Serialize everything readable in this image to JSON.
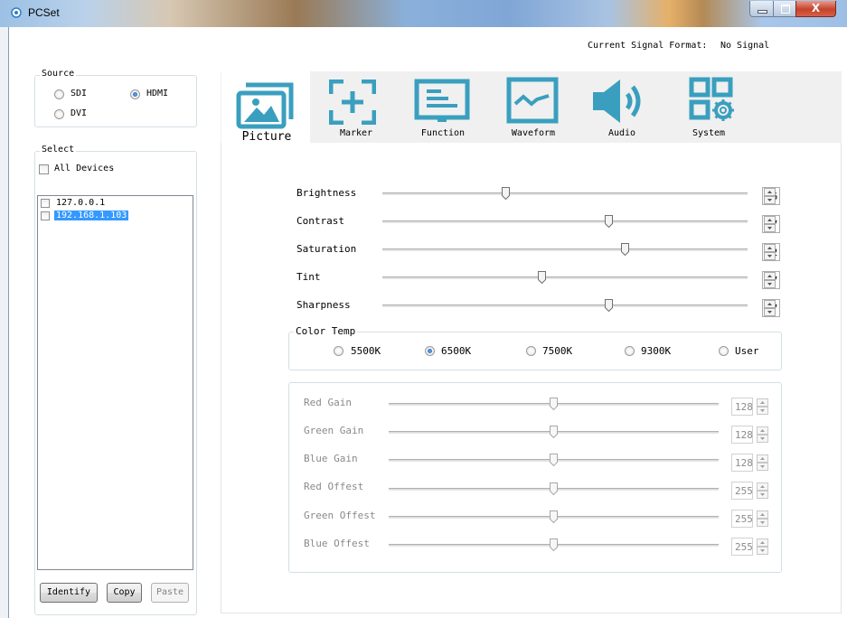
{
  "window": {
    "title": "PCSet",
    "close_glyph": "X"
  },
  "signal": {
    "label": "Current Signal Format:",
    "value": "No Signal"
  },
  "source": {
    "legend": "Source",
    "options": [
      {
        "label": "SDI",
        "selected": false
      },
      {
        "label": "HDMI",
        "selected": true
      },
      {
        "label": "DVI",
        "selected": false
      }
    ]
  },
  "select": {
    "legend": "Select",
    "all_devices": "All Devices",
    "devices": [
      "127.0.0.1",
      "192.168.1.103"
    ]
  },
  "buttons": {
    "identify": "Identify",
    "copy": "Copy",
    "paste": "Paste"
  },
  "tabs": [
    {
      "label": "Picture",
      "icon": "picture-icon",
      "active": true
    },
    {
      "label": "Marker",
      "icon": "marker-icon",
      "active": false
    },
    {
      "label": "Function",
      "icon": "function-icon",
      "active": false
    },
    {
      "label": "Waveform",
      "icon": "waveform-icon",
      "active": false
    },
    {
      "label": "Audio",
      "icon": "audio-icon",
      "active": false
    },
    {
      "label": "System",
      "icon": "system-icon",
      "active": false
    }
  ],
  "picture": {
    "sliders": [
      {
        "label": "Brightness",
        "value": "36"
      },
      {
        "label": "Contrast",
        "value": "67"
      },
      {
        "label": "Saturation",
        "value": "72"
      },
      {
        "label": "Tint",
        "value": "47"
      },
      {
        "label": "Sharpness",
        "value": "67"
      }
    ],
    "color_temp": {
      "legend": "Color Temp",
      "options": [
        "5500K",
        "6500K",
        "7500K",
        "9300K",
        "User"
      ],
      "selected": "6500K"
    },
    "gains": [
      {
        "label": "Red Gain",
        "value": "128"
      },
      {
        "label": "Green Gain",
        "value": "128"
      },
      {
        "label": "Blue Gain",
        "value": "128"
      },
      {
        "label": "Red Offest",
        "value": "255"
      },
      {
        "label": "Green Offest",
        "value": "255"
      },
      {
        "label": "Blue Offest",
        "value": "255"
      }
    ]
  },
  "colors": {
    "accent": "#3a9fbf",
    "selection": "#3399ff"
  }
}
